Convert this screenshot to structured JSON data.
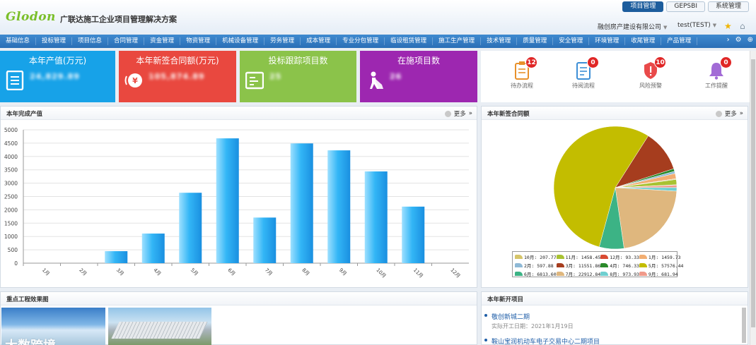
{
  "header": {
    "logo": "Glodon",
    "app_title": "广联达施工企业项目管理解决方案",
    "tabs": [
      "项目管理",
      "GEPSBI",
      "系统管理"
    ],
    "company": "融创房产建设有限公司",
    "user": "test(TEST)"
  },
  "nav": {
    "items": [
      "基础信息",
      "投标管理",
      "项目信息",
      "合同管理",
      "资金管理",
      "物资管理",
      "机械设备管理",
      "劳务管理",
      "成本管理",
      "专业分包管理",
      "临设租赁管理",
      "施工生产管理",
      "技术管理",
      "质量管理",
      "安全管理",
      "环境管理",
      "收尾管理",
      "产品管理"
    ],
    "more_label": "›"
  },
  "stats": [
    {
      "title": "本年产值(万元)",
      "value": "24,829.89",
      "color": "#17a2e8",
      "icon": "document-icon"
    },
    {
      "title": "本年新签合同额(万元)",
      "value": "105,874.89",
      "color": "#e9483f",
      "icon": "money-icon"
    },
    {
      "title": "投标跟踪项目数",
      "value": "25",
      "color": "#8bc34a",
      "icon": "list-icon"
    },
    {
      "title": "在施项目数",
      "value": "26",
      "color": "#9d27b0",
      "icon": "worker-icon"
    }
  ],
  "quick": [
    {
      "label": "待办流程",
      "count": "12",
      "icon": "todo-icon",
      "color": "#e8912b"
    },
    {
      "label": "待阅流程",
      "count": "0",
      "icon": "read-icon",
      "color": "#3d8fd6"
    },
    {
      "label": "风险预警",
      "count": "10",
      "icon": "shield-icon",
      "color": "#e94a4a"
    },
    {
      "label": "工作提醒",
      "count": "0",
      "icon": "bell-icon",
      "color": "#a26bd6"
    }
  ],
  "panels": {
    "bar_title": "本年完成产值",
    "pie_title": "本年新签合同额",
    "images_title": "重点工程效果图",
    "projects_title": "本年新开项目",
    "more": "更多"
  },
  "watermark": "大数跨境",
  "projects": [
    {
      "name": "敬创新城二期",
      "date": "实际开工日期：2021年1月19日"
    },
    {
      "name": "鞍山宝润机动车电子交易中心二期项目",
      "date": ""
    }
  ],
  "chart_data": [
    {
      "type": "bar",
      "categories": [
        "1月",
        "2月",
        "3月",
        "4月",
        "5月",
        "6月",
        "7月",
        "8月",
        "9月",
        "10月",
        "11月",
        "12月"
      ],
      "values": [
        0,
        0,
        450,
        1110,
        2640,
        4680,
        1710,
        4490,
        4230,
        3440,
        2120,
        0
      ],
      "ylim": [
        0,
        5000
      ],
      "yticks": [
        0,
        500,
        1000,
        1500,
        2000,
        2500,
        3000,
        3500,
        4000,
        4500,
        5000
      ],
      "title": "本年完成产值",
      "grid": true
    },
    {
      "type": "pie",
      "title": "本年新签合同额",
      "legend_position": "bottom",
      "slices": [
        {
          "label": "1月",
          "value": 1459.73,
          "color": "#f2ae72"
        },
        {
          "label": "2月",
          "value": 597.88,
          "color": "#8fb9d6"
        },
        {
          "label": "3月",
          "value": 11551.86,
          "color": "#a63d1e"
        },
        {
          "label": "4月",
          "value": 746.33,
          "color": "#2a8a2a"
        },
        {
          "label": "5月",
          "value": 57576.44,
          "color": "#c3bd00"
        },
        {
          "label": "6月",
          "value": 6813.6,
          "color": "#3cb385"
        },
        {
          "label": "7月",
          "value": 22912.84,
          "color": "#dfb77e"
        },
        {
          "label": "8月",
          "value": 973.93,
          "color": "#6fcfd0"
        },
        {
          "label": "9月",
          "value": 681.94,
          "color": "#f09a8a"
        },
        {
          "label": "10月",
          "value": 207.77,
          "color": "#d6c56a"
        },
        {
          "label": "11月",
          "value": 1458.45,
          "color": "#a8c232"
        },
        {
          "label": "12月",
          "value": 93.33,
          "color": "#d94a32"
        }
      ],
      "legend_text": [
        "10月: 207.77",
        "11月: 1458.45",
        "12月: 93.33",
        "1月: 1459.73",
        "2月: 597.88",
        "3月: 11551.86",
        "4月: 746.33",
        "5月: 57576.44",
        "6月: 6813.60",
        "7月: 22912.84",
        "8月: 973.93",
        "9月: 681.94"
      ]
    }
  ]
}
